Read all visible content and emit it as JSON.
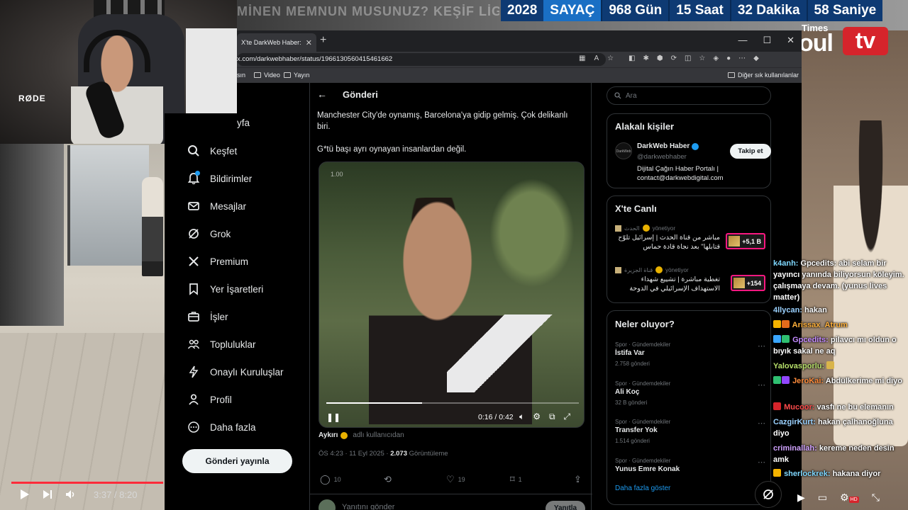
{
  "stream_overlay": {
    "faded_headline": "MİNEN MEMNUN MUSUNUZ? KEŞİF LİGİNİZ",
    "countdown": {
      "year": "2028",
      "label": "SAYAÇ",
      "days": "968 Gün",
      "hours": "15 Saat",
      "minutes": "32 Dakika",
      "seconds": "58 Saniye"
    },
    "logo": {
      "small": "Times",
      "brand": "oul",
      "tv": "tv"
    },
    "webcam_brand": "RØDE",
    "left_video": {
      "time": "3:37 / 8:20"
    }
  },
  "browser": {
    "tab_title": "X'te DarkWeb Haber: \"Ke",
    "url": "x.com/darkwebhaber/status/1966130560415461662",
    "bookmarks": [
      {
        "label": "Video"
      },
      {
        "label": "Yayın"
      }
    ],
    "bookmark_partial": "sın",
    "other_bookmarks": "Diğer sık kullanılanlar"
  },
  "nav": {
    "partial_top": "yfa",
    "items": [
      {
        "label": "Keşfet",
        "icon": "search-icon"
      },
      {
        "label": "Bildirimler",
        "icon": "bell-icon"
      },
      {
        "label": "Mesajlar",
        "icon": "mail-icon"
      },
      {
        "label": "Grok",
        "icon": "grok-icon"
      },
      {
        "label": "Premium",
        "icon": "x-logo-icon"
      },
      {
        "label": "Yer İşaretleri",
        "icon": "bookmark-icon"
      },
      {
        "label": "İşler",
        "icon": "briefcase-icon"
      },
      {
        "label": "Topluluklar",
        "icon": "people-icon"
      },
      {
        "label": "Onaylı Kuruluşlar",
        "icon": "lightning-icon"
      },
      {
        "label": "Profil",
        "icon": "person-icon"
      },
      {
        "label": "Daha fazla",
        "icon": "more-circle-icon"
      }
    ],
    "post_button": "Gönderi yayınla"
  },
  "post": {
    "header_title": "Gönderi",
    "text_line1": "Manchester City'de oynamış, Barcelona'ya gidip gelmiş. Çok delikanlı biri.",
    "text_line2": "G*tü başı ayrı oynayan insanlardan değil.",
    "video": {
      "speed": "1.00",
      "time": "0:16 / 0:42",
      "progress": 0.38
    },
    "author_name": "Aykırı",
    "author_handle": "adlı kullanıcıdan",
    "meta_time": "ÖS 4:23 · 11 Eyl 2025 · ",
    "meta_views": "2.073",
    "meta_views_label": " Görüntüleme",
    "actions": {
      "replies": "10",
      "likes": "19",
      "bookmarks": "1"
    },
    "reply_placeholder": "Yanıtını gönder",
    "reply_button": "Yanıtla"
  },
  "sidebar": {
    "search_placeholder": "Ara",
    "related_title": "Alakalı kişiler",
    "related_person": {
      "name": "DarkWeb Haber",
      "handle": "@darkwebhaber",
      "bio": "Dijital Çağın Haber Portalı | contact@darkwebdigital.com",
      "follow": "Takip et",
      "avatar_text": "DarkWeb"
    },
    "live_title": "X'te Canlı",
    "live": [
      {
        "source": "الحدث",
        "hosting": "yönetiyor",
        "title": "مباشر من قناة الحدث | إسرائيل تلوّح قتابلها\" بعد نجاة قادة حماس",
        "badge": "+5,1 B"
      },
      {
        "source": "قناة الجزيرة",
        "hosting": "yönetiyor",
        "title": "تغطية مباشرة | تشييع شهداء الاستهداف الإسرائيلي في الدوحة",
        "badge": "+154"
      }
    ],
    "trends_title": "Neler oluyor?",
    "trends": [
      {
        "category": "Spor · Gündemdekiler",
        "name": "İstifa Var",
        "count": "2.758 gönderi"
      },
      {
        "category": "Spor · Gündemdekiler",
        "name": "Ali Koç",
        "count": "32 B gönderi"
      },
      {
        "category": "Spor · Gündemdekiler",
        "name": "Transfer Yok",
        "count": "1.514 gönderi"
      },
      {
        "category": "Spor · Gündemdekiler",
        "name": "Yunus Emre Konak",
        "count": ""
      }
    ],
    "show_more": "Daha fazla göster"
  },
  "chat": [
    {
      "user": "k4anh:",
      "user_color": "#7fd8ff",
      "text": "Gpcedits: abi selam bir yayıncı yanında biliyorsun köleyim. çalışmaya devam. (yunus lives matter)"
    },
    {
      "user": "4llycan:",
      "user_color": "#9ad1ff",
      "text": "hakan"
    },
    {
      "user": "Arissax_Atrum",
      "user_color": "#ffb13b",
      "text": ""
    },
    {
      "user": "Gpcedits:",
      "user_color": "#c38aff",
      "text": "pilavcı mı oldun o bıyık sakal ne aq"
    },
    {
      "user": "Yalovasporlu:",
      "user_color": "#b7e06a",
      "text": ""
    },
    {
      "user": "JeroKai:",
      "user_color": "#ff8c3b",
      "text": "Abdülkerime mi diyo"
    },
    {
      "user": "Mucoor:",
      "user_color": "#ff4b4b",
      "text": "vasfı ne bu elemanın"
    },
    {
      "user": "CazgirKurt:",
      "user_color": "#9ad1ff",
      "text": "hakan çalhanoğluna diyo"
    },
    {
      "user": "criminallah:",
      "user_color": "#d0a2ff",
      "text": "kereme neden desin amk"
    },
    {
      "user": "sherlockrek:",
      "user_color": "#7fd8ff",
      "text": "hakana diyor"
    }
  ],
  "colors": {
    "x_bg": "#000000",
    "x_blue": "#1d9bf0",
    "live_pink": "#f91880",
    "progress_red": "#ff2b3a",
    "countdown_dark": "#0e3a73",
    "countdown_light": "#1a6fc4"
  }
}
